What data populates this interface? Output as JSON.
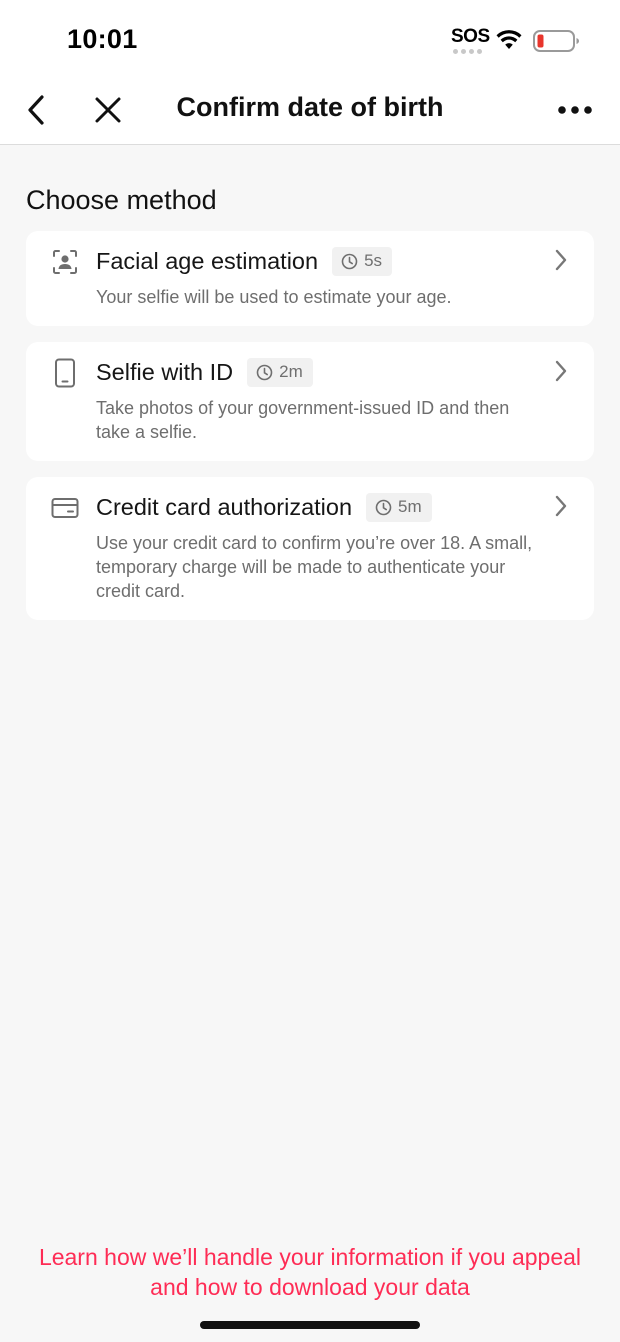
{
  "status_bar": {
    "time": "10:01",
    "sos": "SOS"
  },
  "nav": {
    "title": "Confirm date of birth"
  },
  "section": {
    "title": "Choose method"
  },
  "methods": [
    {
      "icon": "face-scan-icon",
      "title": "Facial age estimation",
      "duration": "5s",
      "description": "Your selfie will be used to estimate your age."
    },
    {
      "icon": "phone-icon",
      "title": "Selfie with ID",
      "duration": "2m",
      "description": "Take photos of your government-issued ID and then take a selfie."
    },
    {
      "icon": "credit-card-icon",
      "title": "Credit card authorization",
      "duration": "5m",
      "description": "Use your credit card to confirm you’re over 18. A small, temporary charge will be made to authenticate your credit card."
    }
  ],
  "footer": {
    "link": "Learn how we’ll handle your information if you appeal and how to download your data"
  },
  "colors": {
    "accent": "#fe2c55",
    "background": "#f7f7f7",
    "card": "#ffffff",
    "battery_low": "#e8352c"
  }
}
